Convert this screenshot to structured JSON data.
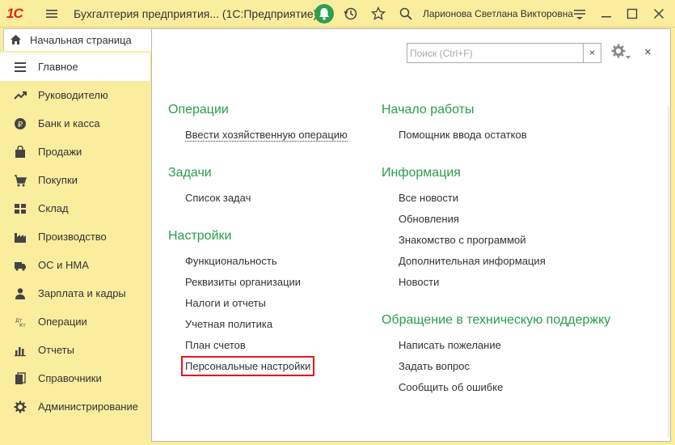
{
  "window": {
    "logo": "1С",
    "title": "Бухгалтерия предприятия... (1С:Предприятие)",
    "user": "Ларионова Светлана Викторовна"
  },
  "tab": {
    "label": "Начальная страница"
  },
  "sidebar": {
    "items": [
      {
        "label": "Главное",
        "icon": "menu-lines-icon"
      },
      {
        "label": "Руководителю",
        "icon": "trend-icon"
      },
      {
        "label": "Банк и касса",
        "icon": "ruble-icon"
      },
      {
        "label": "Продажи",
        "icon": "shopping-bag-icon"
      },
      {
        "label": "Покупки",
        "icon": "cart-icon"
      },
      {
        "label": "Склад",
        "icon": "grid-icon"
      },
      {
        "label": "Производство",
        "icon": "factory-icon"
      },
      {
        "label": "ОС и НМА",
        "icon": "truck-icon"
      },
      {
        "label": "Зарплата и кадры",
        "icon": "person-icon"
      },
      {
        "label": "Операции",
        "icon": "dt-kt-icon"
      },
      {
        "label": "Отчеты",
        "icon": "bar-chart-icon"
      },
      {
        "label": "Справочники",
        "icon": "books-icon"
      },
      {
        "label": "Администрирование",
        "icon": "gear-icon"
      }
    ]
  },
  "search": {
    "placeholder": "Поиск (Ctrl+F)",
    "clear": "×"
  },
  "close": "×",
  "left_column": {
    "operations": {
      "title": "Операции",
      "links": [
        "Ввести хозяйственную операцию"
      ]
    },
    "tasks": {
      "title": "Задачи",
      "links": [
        "Список задач"
      ]
    },
    "settings": {
      "title": "Настройки",
      "links": [
        "Функциональность",
        "Реквизиты организации",
        "Налоги и отчеты",
        "Учетная политика",
        "План счетов",
        "Персональные настройки"
      ]
    }
  },
  "right_column": {
    "start": {
      "title": "Начало работы",
      "links": [
        "Помощник ввода остатков"
      ]
    },
    "info": {
      "title": "Информация",
      "links": [
        "Все новости",
        "Обновления",
        "Знакомство с программой",
        "Дополнительная информация",
        "Новости"
      ]
    },
    "support": {
      "title": "Обращение в техническую поддержку",
      "links": [
        "Написать пожелание",
        "Задать вопрос",
        "Сообщить об ошибке"
      ]
    }
  },
  "colors": {
    "panel_bg": "#fbed9e",
    "section_title": "#2b9d4c",
    "highlight_box": "#e4161b",
    "notification_bell": "#2e9e4f",
    "logo": "#e2231a"
  }
}
